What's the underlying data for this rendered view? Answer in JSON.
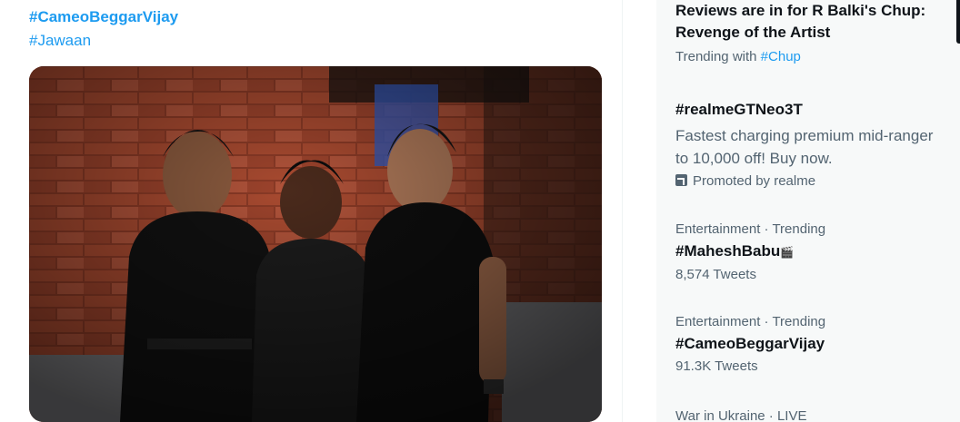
{
  "tweet": {
    "hashtag_primary": "#CameoBeggarVijay",
    "hashtag_secondary": "#Jawaan",
    "photo_caption": "Image shows three men in black outfits posing in front of a brick wall"
  },
  "trends": {
    "items": [
      {
        "title_line1": "Reviews are in for R Balki's Chup:",
        "title_line2": "Revenge of the Artist",
        "meta_prefix": "Trending with",
        "meta_link": "#Chup"
      },
      {
        "title": "#realmeGTNeo3T",
        "desc_line1": "Fastest charging premium mid-ranger",
        "desc_line2": "to 10,000 off! Buy now.",
        "promoted": "Promoted by realme"
      },
      {
        "meta": "Entertainment · Trending",
        "title": "#MaheshBabu",
        "count": "8,574 Tweets"
      },
      {
        "meta": "Entertainment · Trending",
        "title": "#CameoBeggarVijay",
        "count": "91.3K Tweets"
      },
      {
        "meta": "War in Ukraine · LIVE"
      }
    ]
  },
  "icons": {
    "promoted": "promoted-arrow-icon",
    "emoji": "emoji-icon"
  },
  "colors": {
    "accent": "#1d9bf0",
    "secondary_text": "#536471",
    "panel_bg": "#f7f9f9"
  }
}
